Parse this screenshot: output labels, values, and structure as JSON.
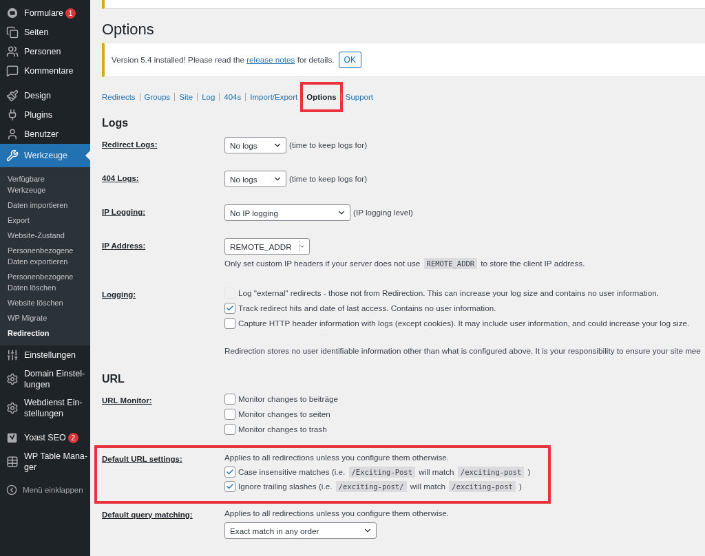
{
  "sidebar": {
    "groups": [
      [
        {
          "label": "Formulare",
          "badge": "1",
          "selected": false
        },
        {
          "label": "Seiten",
          "selected": false
        },
        {
          "label": "Personen",
          "selected": false
        },
        {
          "label": "Kommentare",
          "selected": false
        }
      ],
      [
        {
          "label": "Design",
          "selected": false
        },
        {
          "label": "Plugins",
          "selected": false
        },
        {
          "label": "Benutzer",
          "selected": false
        },
        {
          "label": "Werkzeuge",
          "selected": true,
          "children": [
            {
              "label": "Verfügbare\nWerkzeuge",
              "selected": false
            },
            {
              "label": "Daten importieren",
              "selected": false
            },
            {
              "label": "Export",
              "selected": false
            },
            {
              "label": "Website-Zustand",
              "selected": false
            },
            {
              "label": "Personenbezogene\nDaten exportieren",
              "selected": false
            },
            {
              "label": "Personenbezogene\nDaten löschen",
              "selected": false
            },
            {
              "label": "Website löschen",
              "selected": false
            },
            {
              "label": "WP Migrate",
              "selected": false
            },
            {
              "label": "Redirection",
              "selected": true
            }
          ]
        },
        {
          "label": "Einstellungen",
          "selected": false
        },
        {
          "label": "Domain Einstel-\nlungen",
          "selected": false
        },
        {
          "label": "Webdienst Ein-\nstellungen",
          "selected": false
        }
      ],
      [
        {
          "label": "Yoast SEO",
          "badge": "2",
          "selected": false
        },
        {
          "label": "WP Table Mana-\nger",
          "selected": false
        }
      ]
    ],
    "collapse": "Menü einklappen"
  },
  "page": {
    "title": "Options",
    "notice": {
      "parts": [
        {
          "kind": "text",
          "text": "Version 5.4 installed! Please read the "
        },
        {
          "kind": "link",
          "text": "release notes"
        },
        {
          "kind": "text",
          "text": " for details."
        }
      ],
      "button": "OK"
    },
    "tabs": [
      {
        "label": "Redirects",
        "selected": false,
        "highlighted": false
      },
      {
        "label": "Groups",
        "selected": false,
        "highlighted": false
      },
      {
        "label": "Site",
        "selected": false,
        "highlighted": false
      },
      {
        "label": "Log",
        "selected": false,
        "highlighted": false
      },
      {
        "label": "404s",
        "selected": false,
        "highlighted": false
      },
      {
        "label": "Import/Export",
        "selected": false,
        "highlighted": false
      },
      {
        "label": "Options",
        "selected": true,
        "highlighted": true
      },
      {
        "label": "Support",
        "selected": false,
        "highlighted": false
      }
    ],
    "sections": [
      {
        "title": "Logs",
        "rows": [
          {
            "label": "Redirect Logs:",
            "highlighted": false,
            "controls": [
              {
                "kind": "select",
                "value": "No logs",
                "suffix": "(time to keep logs for)"
              }
            ]
          },
          {
            "label": "404 Logs:",
            "highlighted": false,
            "controls": [
              {
                "kind": "select",
                "value": "No logs",
                "suffix": "(time to keep logs for)"
              }
            ]
          },
          {
            "label": "IP Logging:",
            "highlighted": false,
            "controls": [
              {
                "kind": "select",
                "value": "No IP logging",
                "suffix": "(IP logging level)"
              }
            ]
          },
          {
            "label": "IP Address:",
            "highlighted": false,
            "controls": [
              {
                "kind": "combo",
                "value": "REMOTE_ADDR"
              },
              {
                "kind": "help",
                "parts": [
                  {
                    "kind": "text",
                    "text": "Only set custom IP headers if your server does not use "
                  },
                  {
                    "kind": "code",
                    "text": "REMOTE_ADDR"
                  },
                  {
                    "kind": "text",
                    "text": " to store the client IP address."
                  }
                ]
              }
            ]
          },
          {
            "label": "Logging:",
            "highlighted": false,
            "controls": [
              {
                "kind": "checkbox",
                "checked": false,
                "disabled": true,
                "parts": [
                  {
                    "kind": "text",
                    "text": "Log \"external\" redirects - those not from Redirection. This can increase your log size and contains no user information."
                  }
                ]
              },
              {
                "kind": "checkbox",
                "checked": true,
                "disabled": false,
                "parts": [
                  {
                    "kind": "text",
                    "text": "Track redirect hits and date of last access. Contains no user information."
                  }
                ]
              },
              {
                "kind": "checkbox",
                "checked": false,
                "disabled": false,
                "parts": [
                  {
                    "kind": "text",
                    "text": "Capture HTTP header information with logs (except cookies). It may include user information, and could increase your log size."
                  }
                ]
              },
              {
                "kind": "note",
                "parts": [
                  {
                    "kind": "text",
                    "text": "Redirection stores no user identifiable information other than what is configured above. It is your responsibility to ensure your site mee"
                  }
                ]
              }
            ]
          }
        ]
      },
      {
        "title": "URL",
        "rows": [
          {
            "label": "URL Monitor:",
            "highlighted": false,
            "controls": [
              {
                "kind": "checkbox",
                "checked": false,
                "disabled": false,
                "parts": [
                  {
                    "kind": "text",
                    "text": "Monitor changes to beiträge"
                  }
                ]
              },
              {
                "kind": "checkbox",
                "checked": false,
                "disabled": false,
                "parts": [
                  {
                    "kind": "text",
                    "text": "Monitor changes to seiten"
                  }
                ]
              },
              {
                "kind": "checkbox",
                "checked": false,
                "disabled": false,
                "parts": [
                  {
                    "kind": "text",
                    "text": "Monitor changes to trash"
                  }
                ]
              }
            ]
          },
          {
            "label": "Default URL settings:",
            "highlighted": true,
            "controls": [
              {
                "kind": "help",
                "parts": [
                  {
                    "kind": "text",
                    "text": "Applies to all redirections unless you configure them otherwise."
                  }
                ]
              },
              {
                "kind": "checkbox",
                "checked": true,
                "disabled": false,
                "parts": [
                  {
                    "kind": "text",
                    "text": "Case insensitive matches (i.e. "
                  },
                  {
                    "kind": "code",
                    "text": "/Exciting-Post"
                  },
                  {
                    "kind": "text",
                    "text": " will match "
                  },
                  {
                    "kind": "code",
                    "text": "/exciting-post"
                  },
                  {
                    "kind": "text",
                    "text": " )"
                  }
                ]
              },
              {
                "kind": "checkbox",
                "checked": true,
                "disabled": false,
                "parts": [
                  {
                    "kind": "text",
                    "text": "Ignore trailing slashes (i.e. "
                  },
                  {
                    "kind": "code",
                    "text": "/exciting-post/"
                  },
                  {
                    "kind": "text",
                    "text": " will match "
                  },
                  {
                    "kind": "code",
                    "text": "/exciting-post"
                  },
                  {
                    "kind": "text",
                    "text": " )"
                  }
                ]
              }
            ]
          },
          {
            "label": "Default query matching:",
            "highlighted": false,
            "controls": [
              {
                "kind": "help",
                "parts": [
                  {
                    "kind": "text",
                    "text": "Applies to all redirections unless you configure them otherwise."
                  }
                ]
              },
              {
                "kind": "select",
                "value": "Exact match in any order"
              }
            ]
          }
        ]
      }
    ]
  }
}
